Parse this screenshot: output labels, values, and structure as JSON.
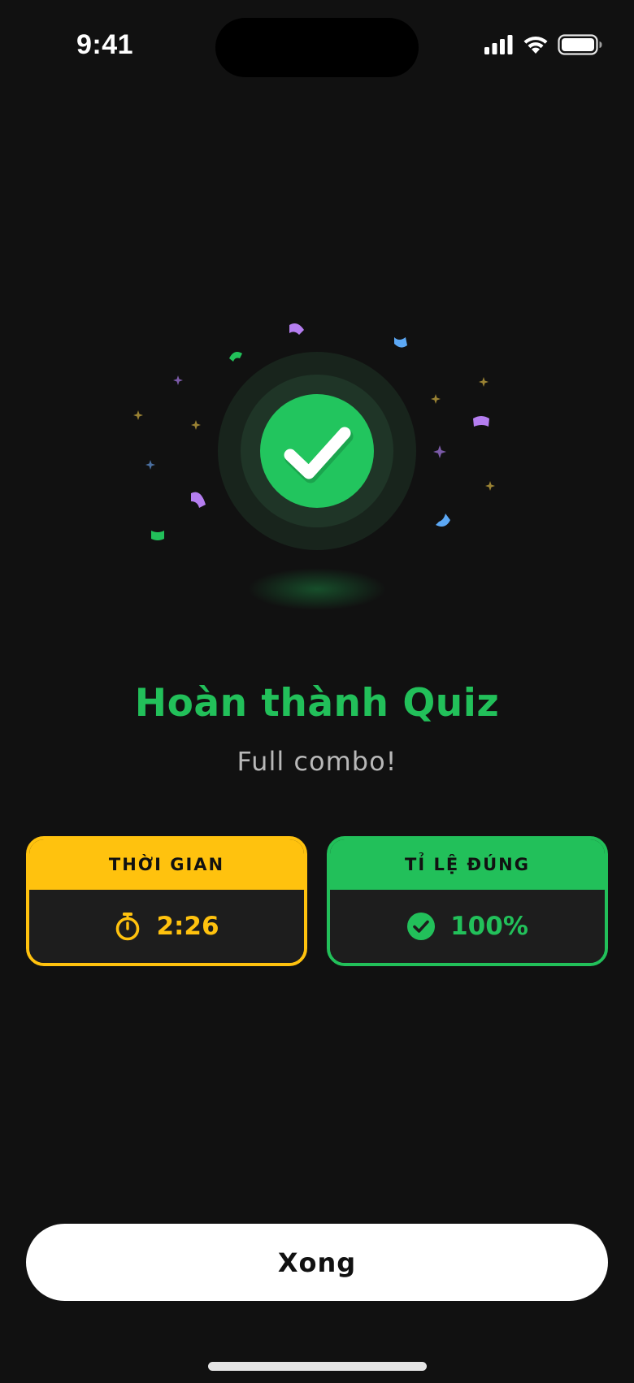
{
  "status_bar": {
    "time": "9:41",
    "icons": [
      "cellular-signal-icon",
      "wifi-icon",
      "battery-icon"
    ]
  },
  "hero": {
    "icon": "check-icon",
    "colors": {
      "circle": "#22c55e",
      "ring_inner": "#1f3a28",
      "ring_outer": "#1a2a1f"
    },
    "confetti_colors": [
      "#b57ef0",
      "#22c05a",
      "#5ca8f5",
      "#ffc20e"
    ]
  },
  "result": {
    "title": "Hoàn thành Quiz",
    "subtitle": "Full combo!"
  },
  "stats": {
    "time": {
      "label": "THỜI GIAN",
      "value": "2:26",
      "icon": "stopwatch-icon",
      "color": "#ffc20e"
    },
    "accuracy": {
      "label": "TỈ LỆ ĐÚNG",
      "value": "100%",
      "icon": "check-circle-icon",
      "color": "#22c05a"
    }
  },
  "actions": {
    "done_label": "Xong"
  }
}
